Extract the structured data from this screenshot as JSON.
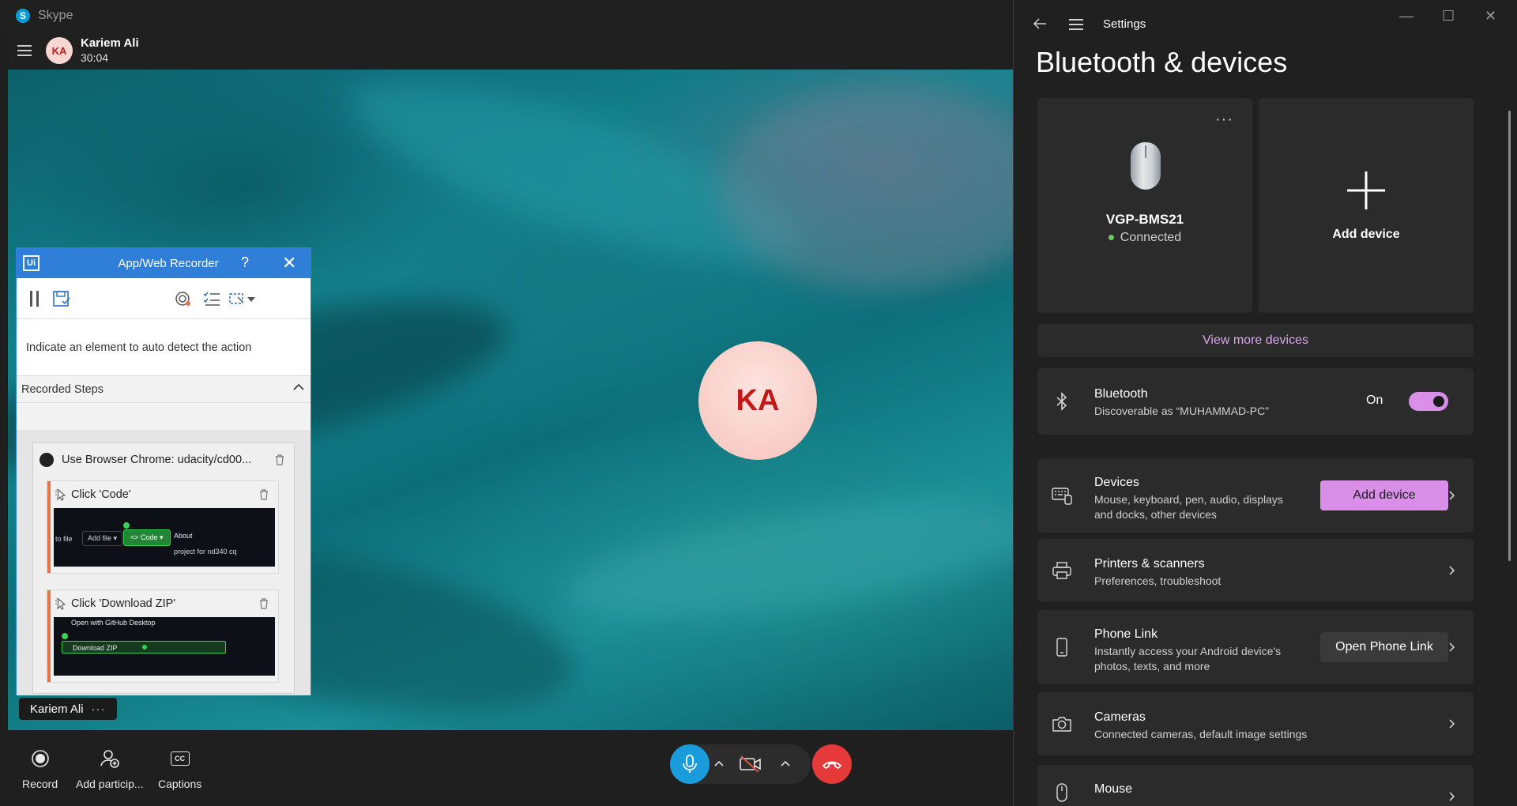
{
  "skype": {
    "window_title": "Skype",
    "caller": {
      "initials": "KA",
      "name": "Kariem Ali",
      "duration": "30:04"
    },
    "video": {
      "avatar_initials": "KA",
      "name_tag": "Kariem Ali",
      "name_tag_more": "···"
    },
    "controls": {
      "record_label": "Record",
      "add_participant_label": "Add particip...",
      "captions_label": "Captions",
      "captions_icon_text": "CC"
    }
  },
  "recorder": {
    "logo": "Ui",
    "title": "App/Web Recorder",
    "help": "?",
    "hint": "Indicate an element to auto detect the action",
    "steps_header": "Recorded Steps",
    "browser_step": "Use Browser Chrome: udacity/cd00...",
    "steps": [
      {
        "label": "Click 'Code'",
        "thumb": {
          "to_file": "to file",
          "add_file": "Add file ▾",
          "code": "<> Code ▾",
          "about": "About",
          "desc": "project for nd340 cq"
        }
      },
      {
        "label": "Click 'Download ZIP'",
        "thumb": {
          "open_desktop": "Open with GitHub Desktop",
          "download_zip": "Download ZIP"
        }
      }
    ]
  },
  "settings": {
    "window_title": "Settings",
    "heading": "Bluetooth & devices",
    "device_tile": {
      "name": "VGP-BMS21",
      "status": "Connected",
      "more": "···"
    },
    "add_tile_label": "Add device",
    "view_more": "View more devices",
    "bluetooth": {
      "title": "Bluetooth",
      "subtitle": "Discoverable as “MUHAMMAD-PC”",
      "state": "On"
    },
    "devices": {
      "title": "Devices",
      "subtitle_1": "Mouse, keyboard, pen, audio, displays",
      "subtitle_2": "and docks, other devices",
      "button": "Add device"
    },
    "printers": {
      "title": "Printers & scanners",
      "subtitle": "Preferences, troubleshoot"
    },
    "phone_link": {
      "title": "Phone Link",
      "subtitle_1": "Instantly access your Android device's",
      "subtitle_2": "photos, texts, and more",
      "button": "Open Phone Link"
    },
    "cameras": {
      "title": "Cameras",
      "subtitle": "Connected cameras, default image settings"
    },
    "mouse": {
      "title": "Mouse"
    },
    "colors": {
      "accent": "#d98fe8",
      "link": "#d8a8e8",
      "connected": "#6ccb5f"
    }
  }
}
